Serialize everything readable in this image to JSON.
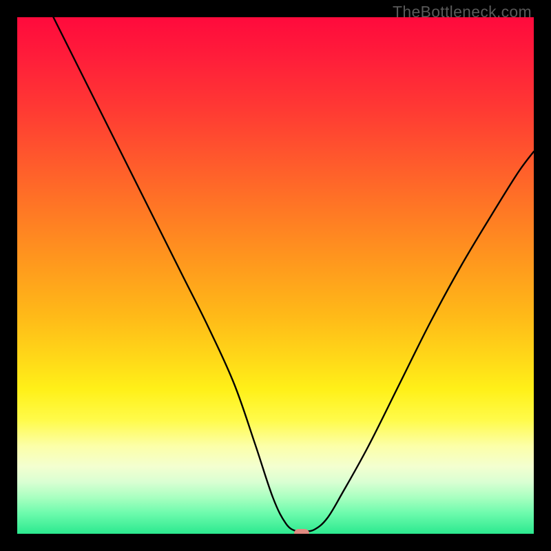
{
  "watermark": "TheBottleneck.com",
  "chart_data": {
    "type": "line",
    "title": "",
    "xlabel": "",
    "ylabel": "",
    "xlim": [
      0,
      100
    ],
    "ylim": [
      0,
      100
    ],
    "series": [
      {
        "name": "bottleneck-curve",
        "x": [
          7,
          12,
          17,
          22,
          27,
          32,
          37,
          42,
          46,
          49.5,
          52,
          54,
          55.5,
          57.5,
          60,
          63,
          68,
          74,
          80,
          86,
          92,
          97,
          100
        ],
        "y": [
          100,
          90,
          80,
          70,
          60,
          50,
          40,
          29,
          17.5,
          7,
          2,
          0.5,
          0.5,
          0.8,
          3,
          8,
          17,
          29,
          41,
          52,
          62,
          70,
          74
        ]
      }
    ],
    "marker": {
      "x": 55,
      "y": 0.2,
      "color": "#e18a81"
    },
    "background_gradient": {
      "top": "#ff0a3c",
      "mid": "#ffd818",
      "bottom": "#2ce98f"
    }
  }
}
